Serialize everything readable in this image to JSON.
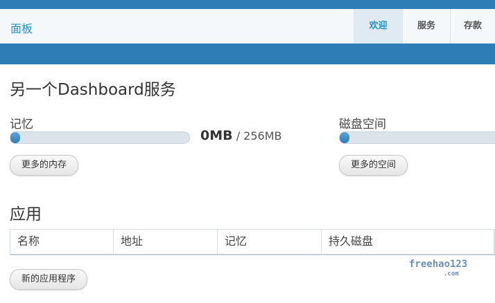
{
  "navbar": {
    "brand": "面板",
    "tabs": [
      {
        "label": "欢迎",
        "active": true
      },
      {
        "label": "服务",
        "active": false
      },
      {
        "label": "存款",
        "active": false
      }
    ]
  },
  "page": {
    "title": "另一个Dashboard服务"
  },
  "memory": {
    "label": "记忆",
    "used": "0MB",
    "separator": " / ",
    "total": "256MB",
    "button": "更多的内存",
    "usage_fraction": 0.0
  },
  "disk": {
    "label": "磁盘空间",
    "button": "更多的空间",
    "usage_fraction": 0.0
  },
  "apps": {
    "title": "应用",
    "columns": [
      "名称",
      "地址",
      "记忆",
      "持久磁盘"
    ],
    "new_button": "新的应用程序"
  },
  "watermark": {
    "text": "freehao123",
    "suffix": ".com"
  },
  "colors": {
    "header_blue": "#2f7db6",
    "accent": "#2a8fc4",
    "navbar_bg": "#f4f8fb"
  }
}
